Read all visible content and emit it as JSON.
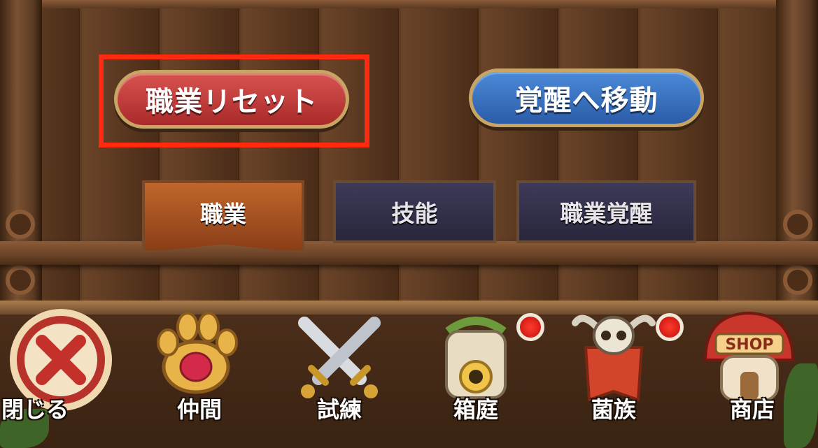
{
  "buttons": {
    "job_reset": "職業リセット",
    "go_awakening": "覚醒へ移動"
  },
  "tabs": [
    {
      "label": "職業",
      "active": true
    },
    {
      "label": "技能",
      "active": false
    },
    {
      "label": "職業覚醒",
      "active": false
    }
  ],
  "bottom_nav": [
    {
      "label": "閉じる",
      "icon": "close-icon",
      "badge": false
    },
    {
      "label": "仲間",
      "icon": "paw-icon",
      "badge": false
    },
    {
      "label": "試練",
      "icon": "crossed-swords-icon",
      "badge": false
    },
    {
      "label": "箱庭",
      "icon": "tower-icon",
      "badge": true
    },
    {
      "label": "菌族",
      "icon": "skull-banner-icon",
      "badge": true
    },
    {
      "label": "商店",
      "icon": "mushroom-shop-icon",
      "badge": false,
      "sign_text": "SHOP"
    }
  ],
  "colors": {
    "highlight": "#ff2a10",
    "red_button": "#c03a37",
    "blue_button": "#3a74c2",
    "active_tab": "#a8512a",
    "inactive_tab": "#33314b"
  }
}
